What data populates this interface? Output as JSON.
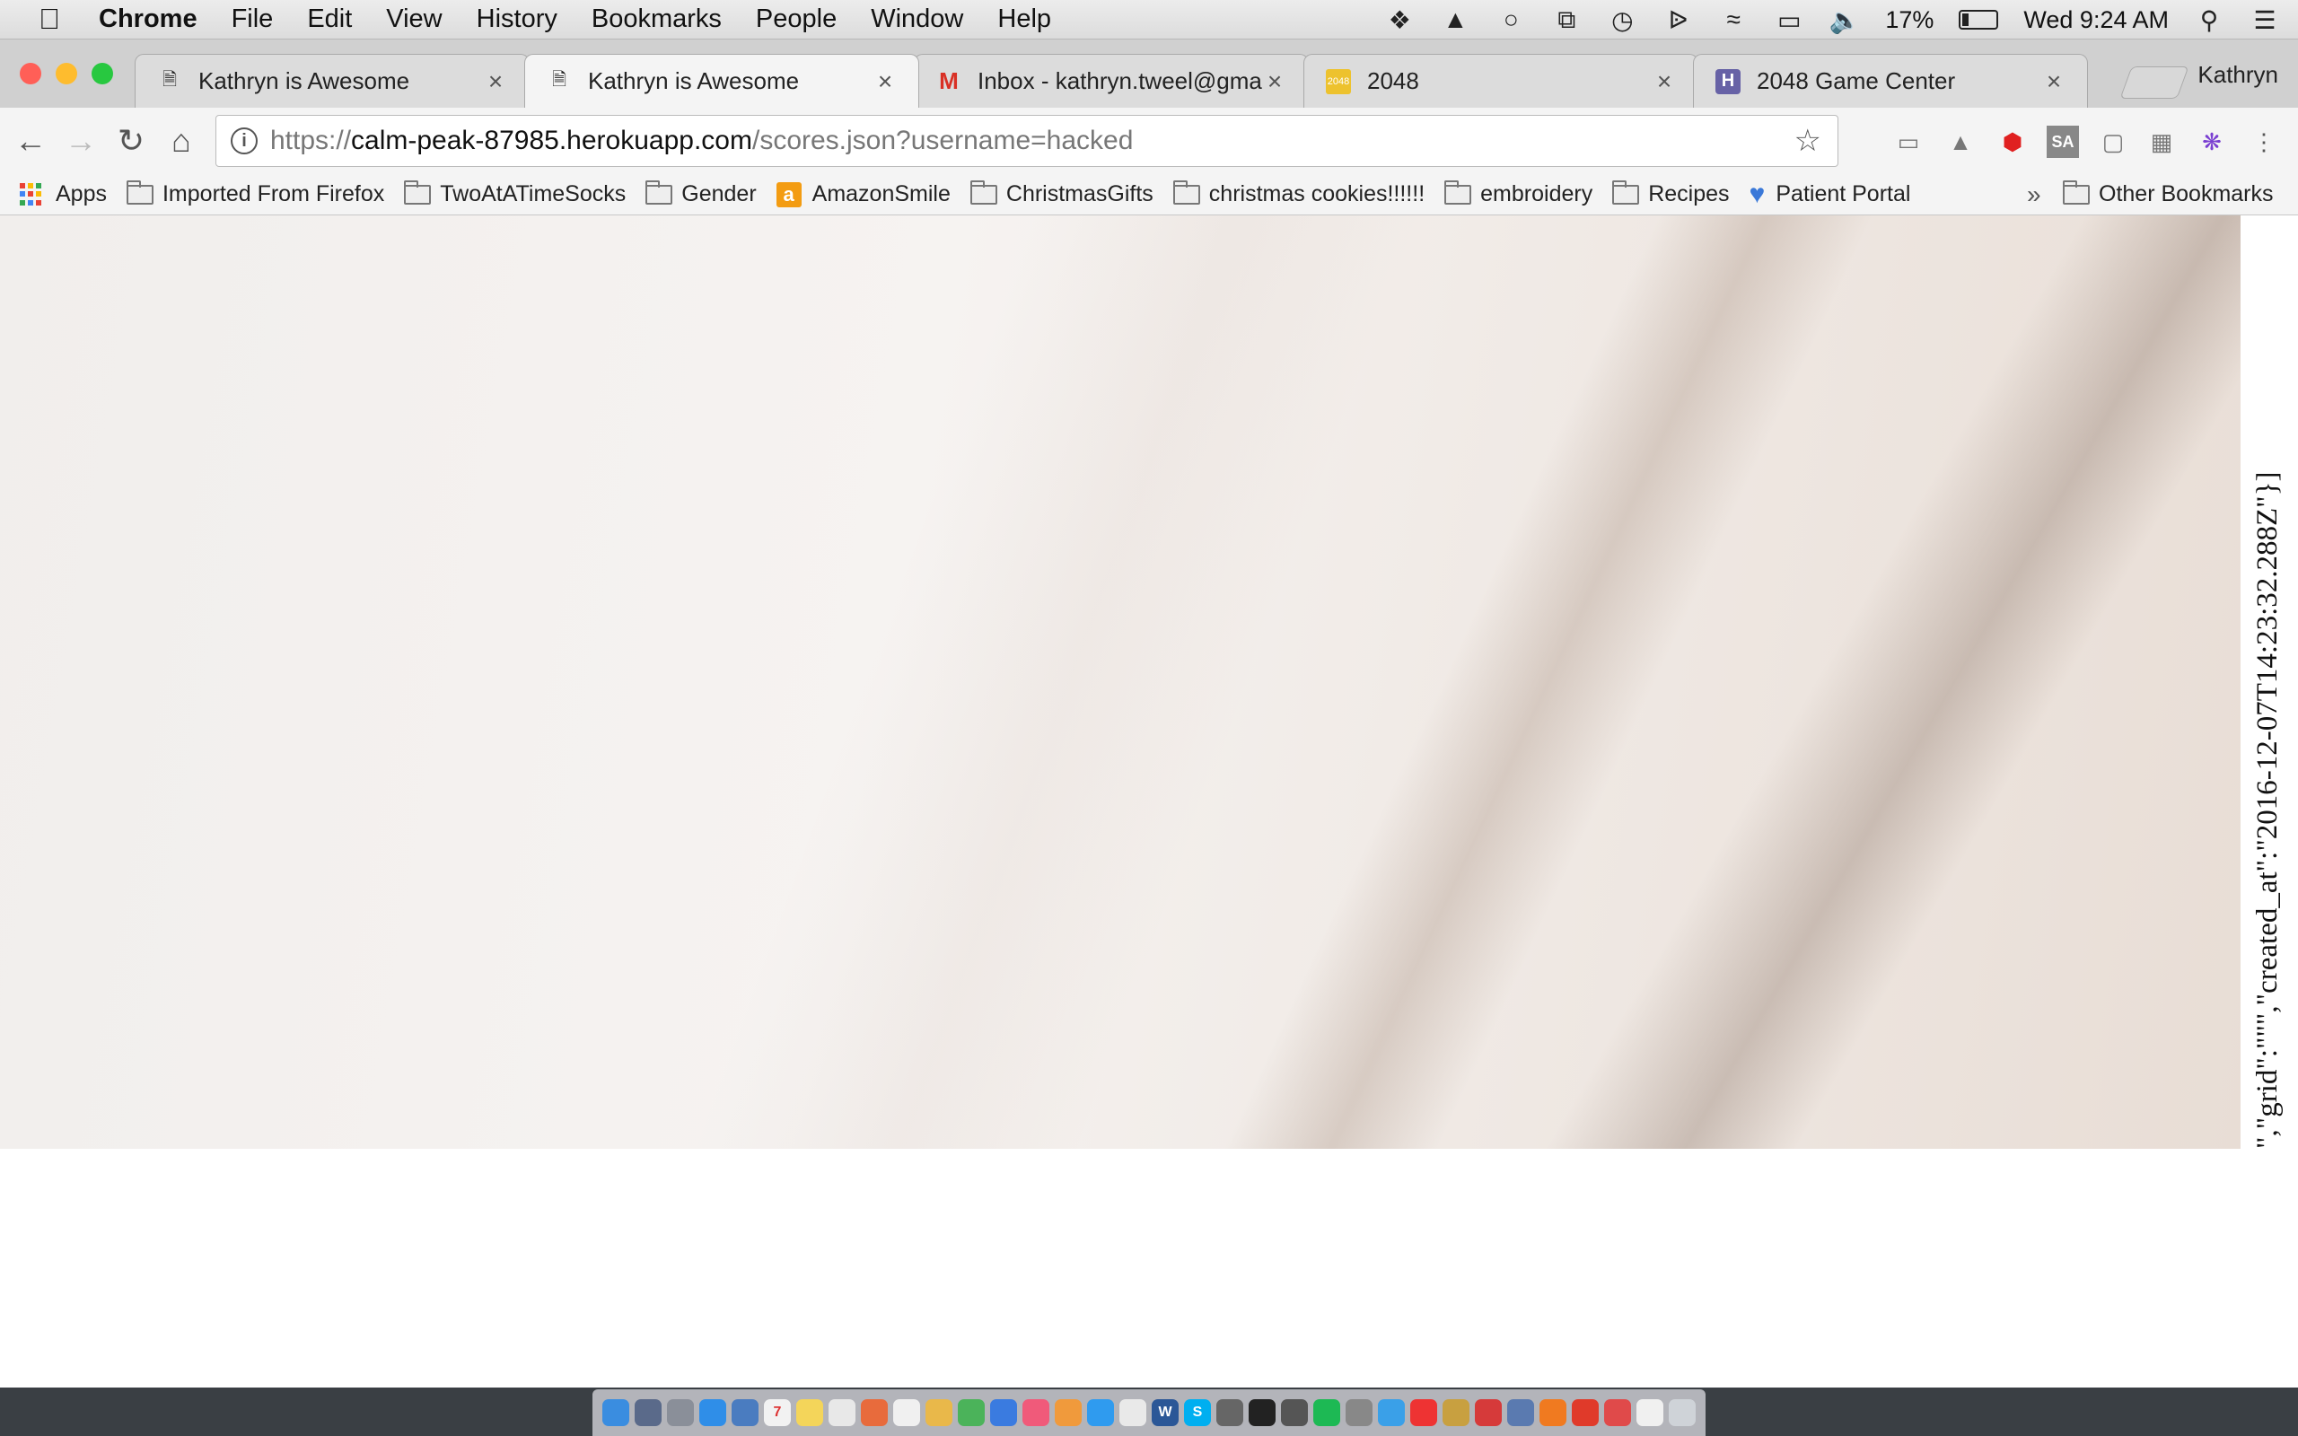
{
  "menubar": {
    "app_name": "Chrome",
    "items": [
      "File",
      "Edit",
      "View",
      "History",
      "Bookmarks",
      "People",
      "Window",
      "Help"
    ],
    "battery_percent": "17%",
    "battery_level": 0.17,
    "clock": "Wed 9:24 AM"
  },
  "tabs": [
    {
      "title": "Kathryn is Awesome",
      "icon": "page-icon",
      "active": false
    },
    {
      "title": "Kathryn is Awesome",
      "icon": "page-icon",
      "active": true
    },
    {
      "title": "Inbox - kathryn.tweel@gmail.c",
      "icon": "gmail-icon",
      "active": false
    },
    {
      "title": "2048",
      "icon": "2048-icon",
      "active": false
    },
    {
      "title": "2048 Game Center",
      "icon": "heroku-icon",
      "active": false
    }
  ],
  "profile_name": "Kathryn",
  "omnibox": {
    "scheme": "https://",
    "host": "calm-peak-87985.herokuapp.com",
    "path": "/scores.json?username=hacked"
  },
  "bookmarks": {
    "apps_label": "Apps",
    "items": [
      {
        "label": "Imported From Firefox",
        "icon": "folder-icon"
      },
      {
        "label": "TwoAtATimeSocks",
        "icon": "folder-icon"
      },
      {
        "label": "Gender",
        "icon": "folder-icon"
      },
      {
        "label": "AmazonSmile",
        "icon": "amazon-icon"
      },
      {
        "label": "ChristmasGifts",
        "icon": "folder-icon"
      },
      {
        "label": "christmas cookies!!!!!!",
        "icon": "folder-icon"
      },
      {
        "label": "embroidery",
        "icon": "folder-icon"
      },
      {
        "label": "Recipes",
        "icon": "folder-icon"
      },
      {
        "label": "Patient Portal",
        "icon": "heart-icon"
      }
    ],
    "more": "»",
    "other": "Other Bookmarks"
  },
  "page": {
    "json_text": "\",\"grid\":\"\"\",\"created_at\":\"2016-12-07T14:23:32.288Z\"}]"
  },
  "colors": {
    "close": "#ff5f57",
    "minimize": "#febc2e",
    "maximize": "#28c840",
    "gmail_red": "#d93025",
    "tile_2048": "#edc22e",
    "heroku_purple": "#6762a6"
  }
}
